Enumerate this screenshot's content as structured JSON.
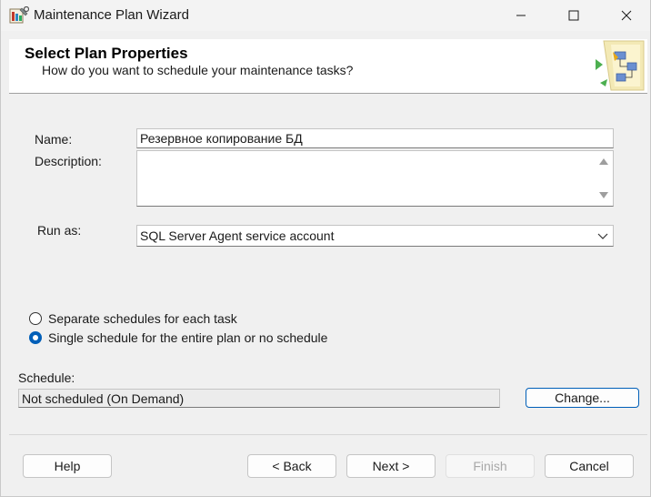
{
  "window": {
    "title": "Maintenance Plan Wizard"
  },
  "header": {
    "title": "Select Plan Properties",
    "subtitle": "How do you want to schedule your maintenance tasks?"
  },
  "form": {
    "name_label": "Name:",
    "name_value": "Резервное копирование БД",
    "description_label": "Description:",
    "description_value": "",
    "run_as_label": "Run as:",
    "run_as_value": "SQL Server Agent service account"
  },
  "schedule_options": [
    {
      "label": "Separate schedules for each task",
      "checked": false
    },
    {
      "label": "Single schedule for the entire plan or no schedule",
      "checked": true
    }
  ],
  "schedule": {
    "label": "Schedule:",
    "value": "Not scheduled (On Demand)",
    "change_button": "Change..."
  },
  "footer": {
    "help": "Help",
    "back": "< Back",
    "next": "Next >",
    "finish": "Finish",
    "cancel": "Cancel"
  },
  "icons": {
    "app": "maintenance-plan-icon",
    "minimize": "minimize-icon",
    "maximize": "maximize-icon",
    "close": "close-icon",
    "header_graphic": "wizard-graphic-icon",
    "dropdown": "chevron-down-icon"
  },
  "colors": {
    "accent": "#005fb8",
    "window_bg": "#f0f0f0",
    "header_bg": "#ffffff"
  }
}
